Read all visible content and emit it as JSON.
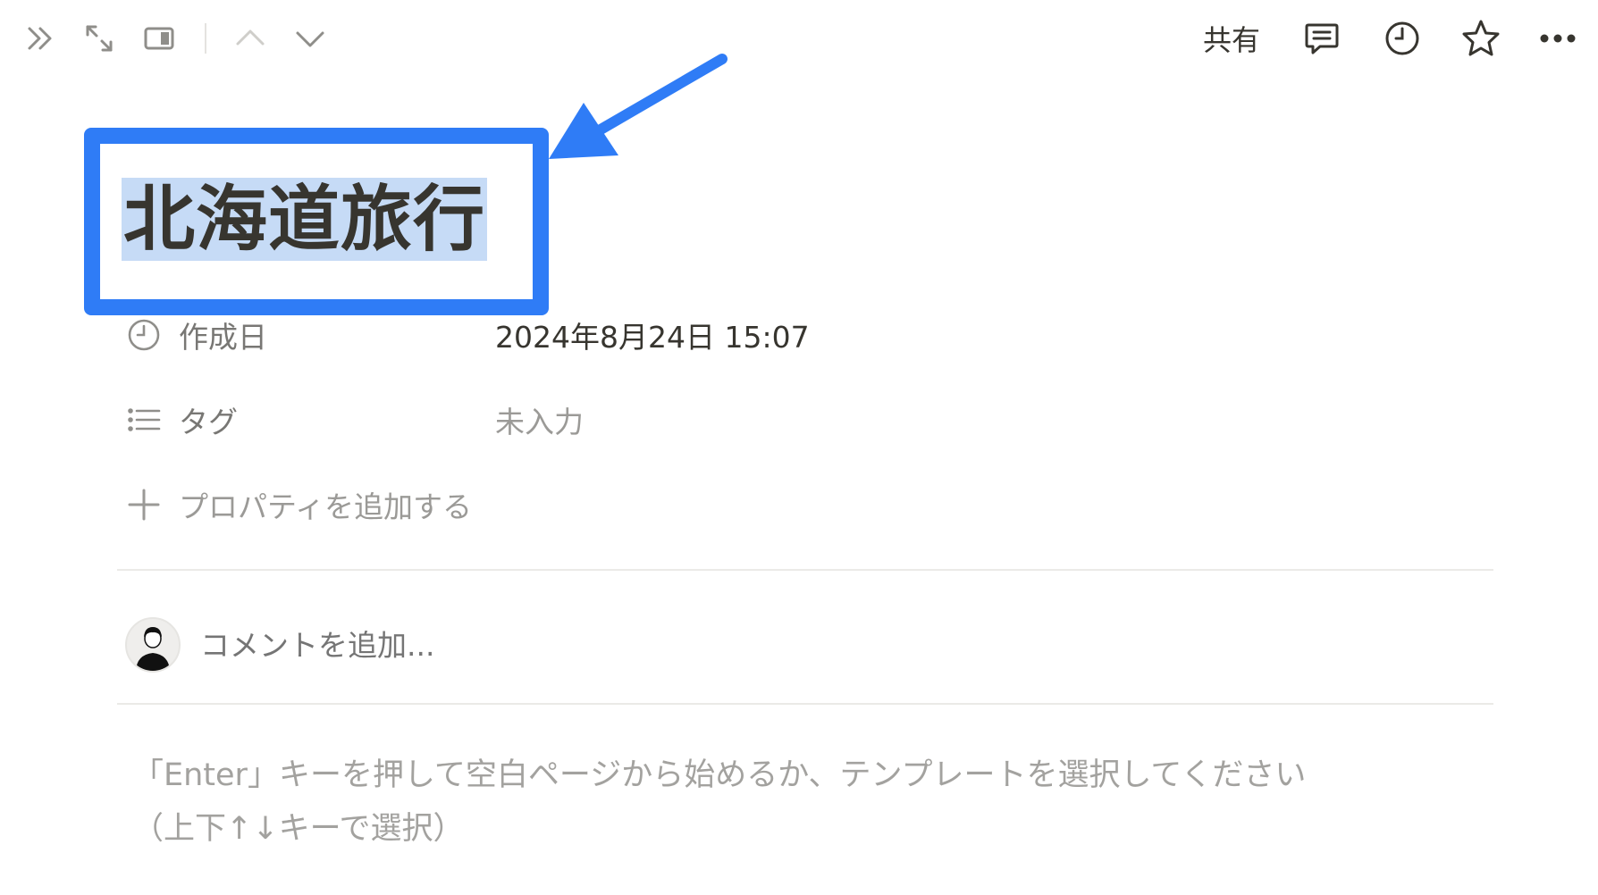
{
  "toolbar": {
    "share_label": "共有",
    "left_icons": [
      "double-chevron-right-icon",
      "expand-icon",
      "side-peek-icon",
      "chevron-up-icon",
      "chevron-down-icon"
    ],
    "right_icons": [
      "comment-icon",
      "clock-icon",
      "star-icon",
      "more-icon"
    ]
  },
  "page": {
    "title": "北海道旅行"
  },
  "properties": [
    {
      "icon": "clock-icon",
      "name": "作成日",
      "value": "2024年8月24日 15:07",
      "empty": false
    },
    {
      "icon": "list-icon",
      "name": "タグ",
      "value": "未入力",
      "empty": true
    }
  ],
  "add_property_label": "プロパティを追加する",
  "comment": {
    "placeholder": "コメントを追加..."
  },
  "hint": {
    "line1": "「Enter」キーを押して空白ページから始めるか、テンプレートを選択してください",
    "line2": "（上下↑↓キーで選択）"
  },
  "colors": {
    "annotation_blue": "#2f7cf6",
    "selection": "#c6dbf6",
    "text": "#37352f",
    "muted": "#9b9a97"
  }
}
